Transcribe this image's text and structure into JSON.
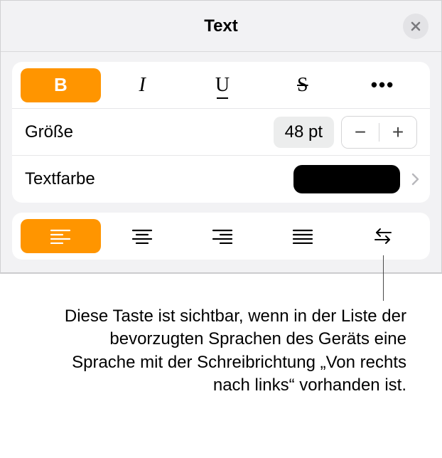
{
  "header": {
    "title": "Text"
  },
  "styleButtons": {
    "bold": "B",
    "italic": "I",
    "underline": "U",
    "strike": "S",
    "more": "•••"
  },
  "sizeRow": {
    "label": "Größe",
    "value": "48 pt",
    "minus": "−",
    "plus": "+"
  },
  "colorRow": {
    "label": "Textfarbe"
  },
  "callout": "Diese Taste ist sichtbar, wenn in der Liste der bevorzugten Sprachen des Geräts eine Sprache mit der Schreibrichtung „Von rechts nach links“ vorhanden ist."
}
